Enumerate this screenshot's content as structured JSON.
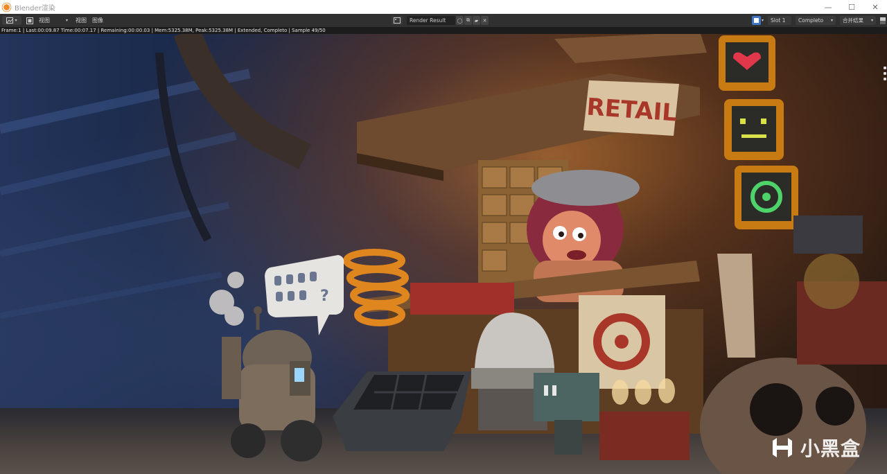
{
  "window": {
    "title": "Blender渲染",
    "controls": [
      "—",
      "☐",
      "✕"
    ]
  },
  "header": {
    "editor_type_icon": "image-editor-icon",
    "view_label": "视图",
    "menu_view": "视图",
    "menu_image": "图像",
    "image_name": "Render Result",
    "slot": "Slot 1",
    "view_layer": "Completo",
    "pass": "合并结果"
  },
  "status": {
    "text": "Frame:1 | Last:00:09.87 Time:00:07.17 | Remaining:00:00.03 | Mem:5325.38M, Peak:5325.38M | Extended, Completo | Sample 49/50"
  },
  "render": {
    "sign_text": "RETAIL",
    "speech_bubble_text": "?"
  },
  "watermark": {
    "text": "小黑盒"
  },
  "colors": {
    "accent": "#3e75c9",
    "sign_red": "#a8372a",
    "titlebar_bg": "#ffffff",
    "header_bg": "#303030"
  }
}
